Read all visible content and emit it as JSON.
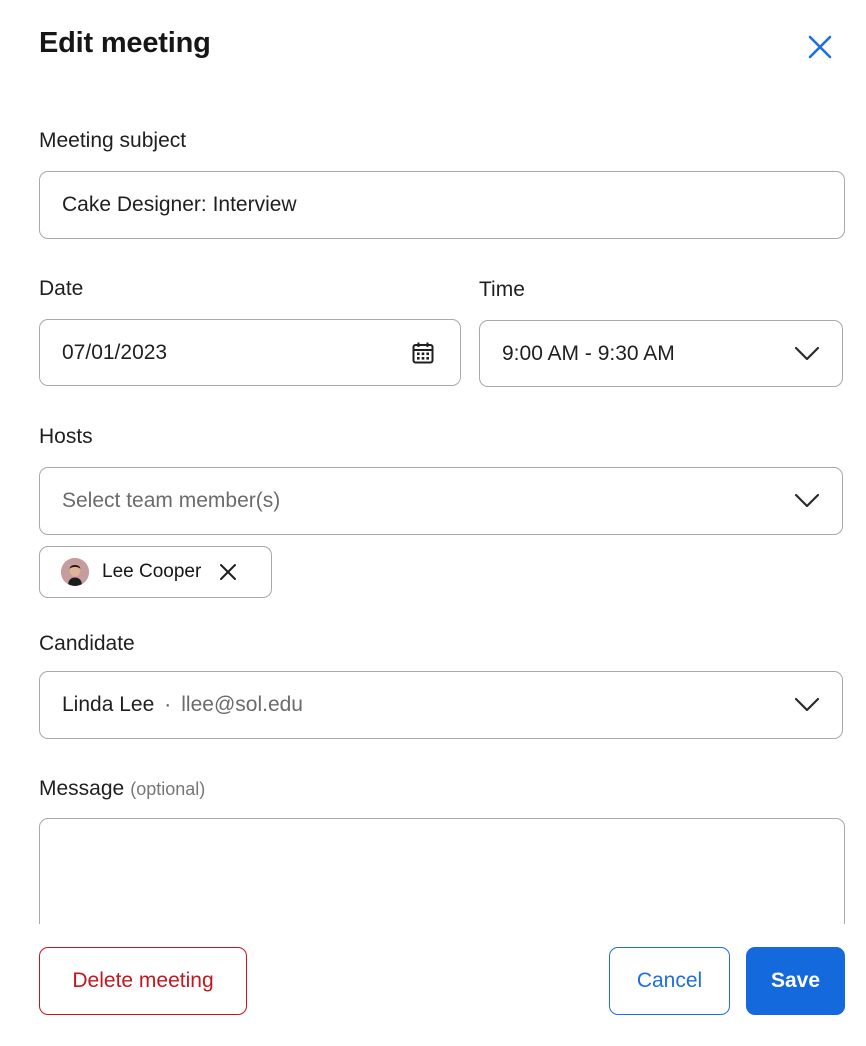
{
  "dialog": {
    "title": "Edit meeting"
  },
  "subject": {
    "label": "Meeting subject",
    "value": "Cake Designer: Interview"
  },
  "date": {
    "label": "Date",
    "value": "07/01/2023"
  },
  "time": {
    "label": "Time",
    "value": "9:00 AM - 9:30 AM"
  },
  "hosts": {
    "label": "Hosts",
    "placeholder": "Select team member(s)",
    "selected": [
      {
        "name": "Lee Cooper"
      }
    ]
  },
  "candidate": {
    "label": "Candidate",
    "name": "Linda Lee",
    "separator": "·",
    "email": "llee@sol.edu"
  },
  "message": {
    "label": "Message",
    "optional": "(optional)",
    "value": ""
  },
  "actions": {
    "delete": "Delete meeting",
    "cancel": "Cancel",
    "save": "Save"
  },
  "colors": {
    "accent": "#1469dc",
    "danger": "#c2171f",
    "border": "#a9a9a9"
  },
  "icons": {
    "close": "close-icon",
    "calendar": "calendar-icon",
    "chevron": "chevron-down-icon",
    "chip_remove": "close-icon",
    "avatar": "avatar"
  }
}
